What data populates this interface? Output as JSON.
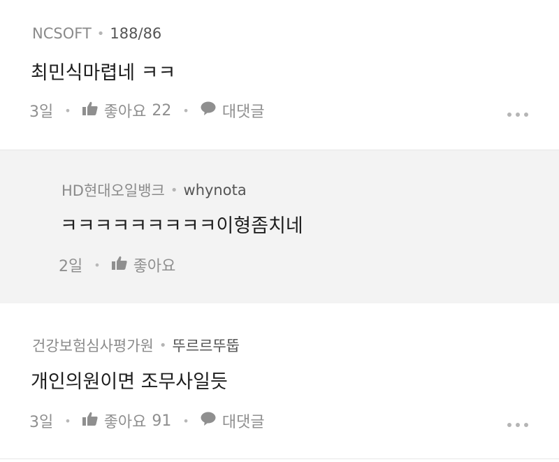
{
  "comments": [
    {
      "company": "NCSOFT",
      "nickname": "188/86",
      "body": "최민식마렵네 ㅋㅋ",
      "time": "3일",
      "like_label": "좋아요",
      "like_count": "22",
      "reply_label": "대댓글"
    },
    {
      "company": "HD현대오일뱅크",
      "nickname": "whynota",
      "body": "ㅋㅋㅋㅋㅋㅋㅋㅋㅋ이형좀치네",
      "time": "2일",
      "like_label": "좋아요"
    },
    {
      "company": "건강보험심사평가원",
      "nickname": "뚜르르뚜뚭",
      "body": "개인의원이면 조무사일듯",
      "time": "3일",
      "like_label": "좋아요",
      "like_count": "91",
      "reply_label": "대댓글"
    }
  ],
  "separator": "•",
  "icons": {
    "like": "thumbs-up-icon",
    "reply": "speech-bubble-icon",
    "more": "more-options-icon"
  },
  "colors": {
    "reply_background": "#f3f3f3",
    "text": "#1e1e1e",
    "muted": "#8f8f8f"
  }
}
